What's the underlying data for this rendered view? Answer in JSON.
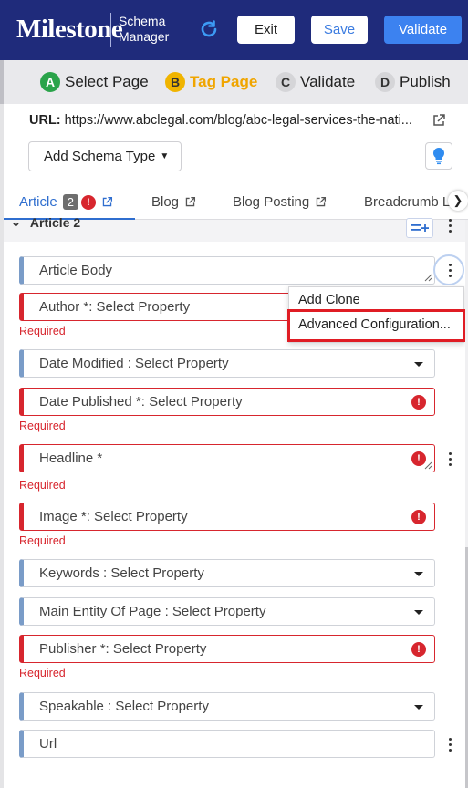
{
  "header": {
    "logo": "Milestone",
    "product_line1": "Schema",
    "product_line2": "Manager",
    "exit_label": "Exit",
    "save_label": "Save",
    "validate_label": "Validate"
  },
  "steps": [
    {
      "letter": "A",
      "label": "Select Page"
    },
    {
      "letter": "B",
      "label": "Tag Page"
    },
    {
      "letter": "C",
      "label": "Validate"
    },
    {
      "letter": "D",
      "label": "Publish"
    }
  ],
  "url": {
    "label": "URL:",
    "value": "https://www.abclegal.com/blog/abc-legal-services-the-nati..."
  },
  "add_schema_label": "Add Schema Type",
  "tabs": [
    {
      "label": "Article",
      "badge": "2",
      "alert": "!"
    },
    {
      "label": "Blog"
    },
    {
      "label": "Blog Posting"
    },
    {
      "label": "Breadcrumb L"
    }
  ],
  "section": {
    "title": "Article 2"
  },
  "fields": [
    {
      "label": "Article Body",
      "required_text": ""
    },
    {
      "label": "Author *: Select Property",
      "required_text": "Required"
    },
    {
      "label": "Date Modified : Select Property",
      "required_text": ""
    },
    {
      "label": "Date Published *: Select Property",
      "required_text": "Required"
    },
    {
      "label": "Headline *",
      "required_text": "Required"
    },
    {
      "label": "Image *: Select Property",
      "required_text": "Required"
    },
    {
      "label": "Keywords : Select Property",
      "required_text": ""
    },
    {
      "label": "Main Entity Of Page : Select Property",
      "required_text": ""
    },
    {
      "label": "Publisher *: Select Property",
      "required_text": "Required"
    },
    {
      "label": "Speakable : Select Property",
      "required_text": ""
    },
    {
      "label": "Url",
      "required_text": ""
    }
  ],
  "error_glyph": "!",
  "context_menu": {
    "items": [
      "Add Clone",
      "Advanced Configuration..."
    ]
  },
  "colors": {
    "header_bg": "#1f2b7b",
    "accent_blue": "#3c82f0",
    "required_red": "#d7262e",
    "step_a_green": "#2aa34a",
    "step_b_yellow": "#f0b400"
  }
}
